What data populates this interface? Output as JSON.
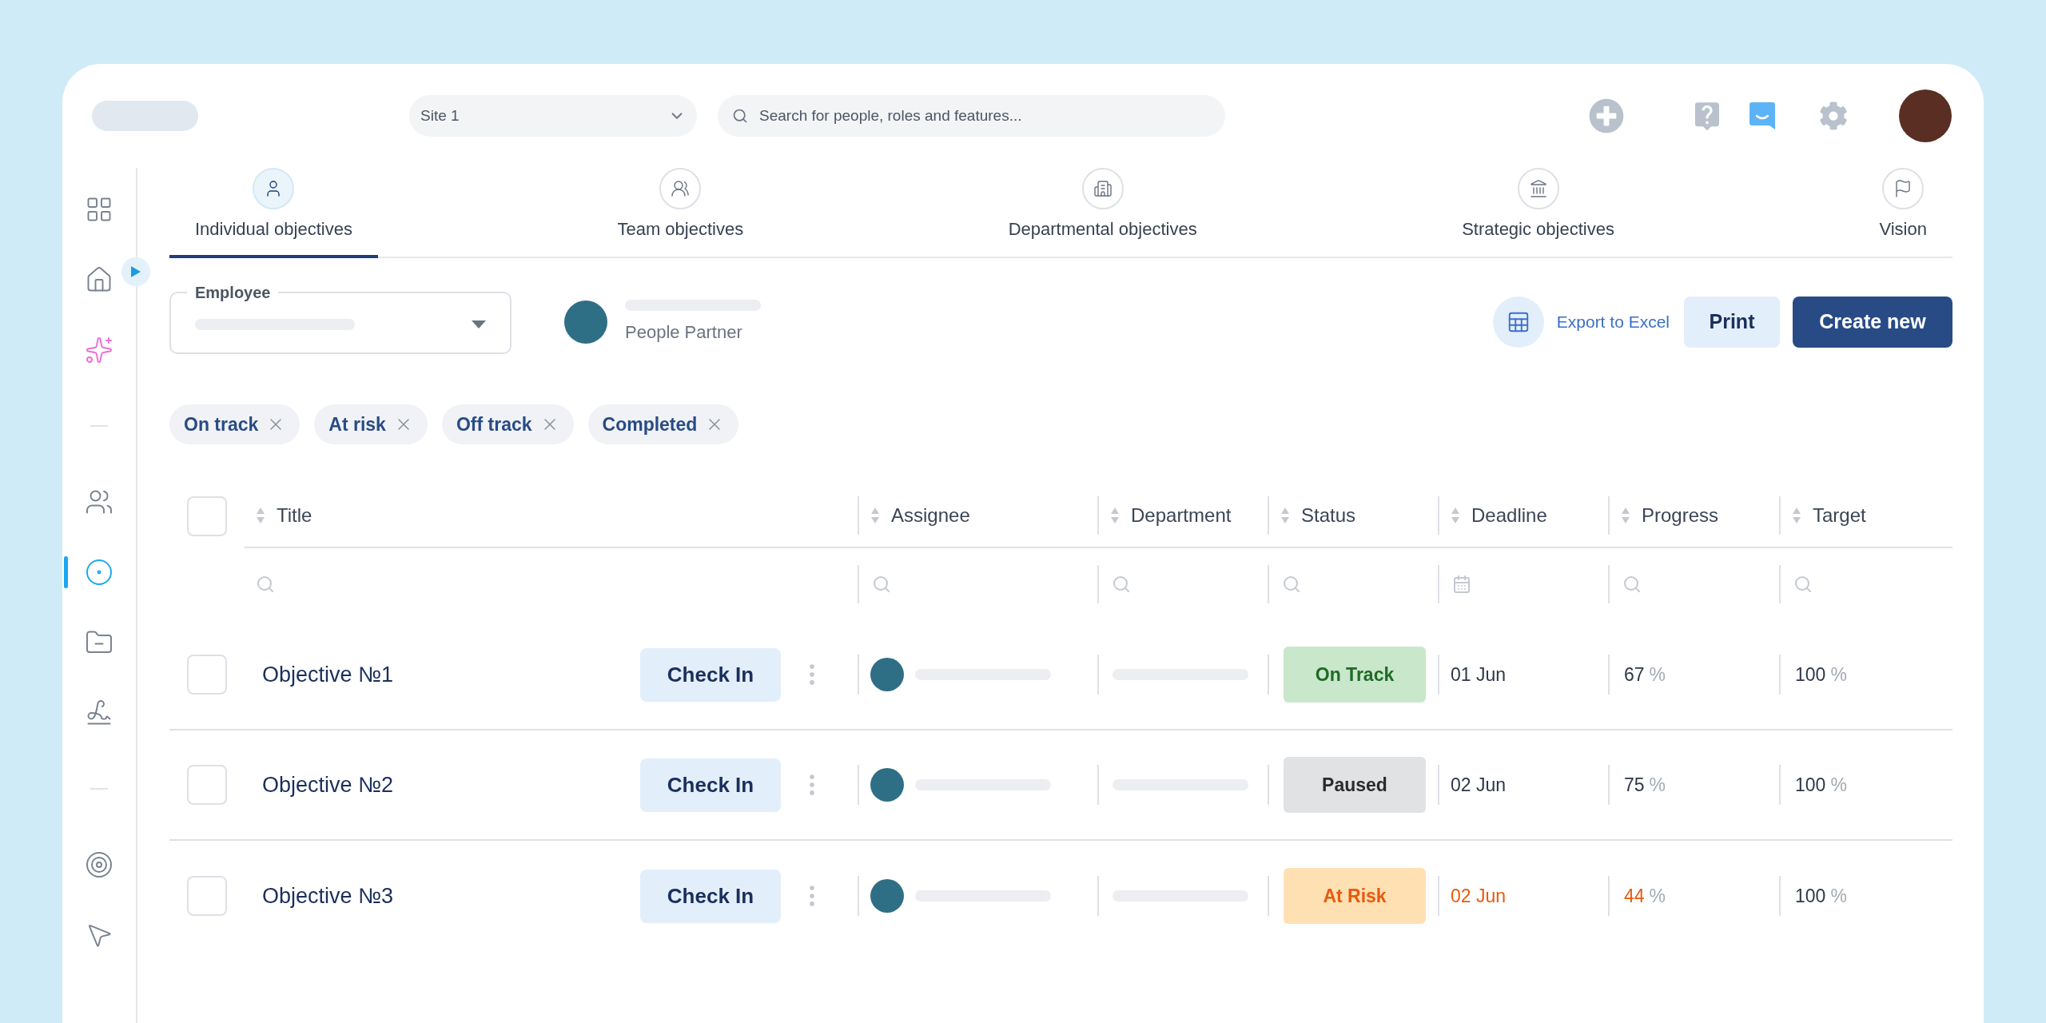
{
  "top_bar": {
    "site_select": {
      "value": "Site 1"
    },
    "search": {
      "placeholder": "Search for people, roles and features..."
    }
  },
  "sidebar": {
    "expanded": false,
    "items": [
      {
        "selected": false
      },
      {
        "selected": false
      },
      {
        "selected": false
      },
      {
        "selected": false
      },
      {
        "selected": true
      },
      {
        "selected": false
      },
      {
        "selected": false
      },
      {
        "selected": false
      },
      {
        "selected": false
      }
    ]
  },
  "tabs": [
    {
      "label": "Individual objectives",
      "selected": true
    },
    {
      "label": "Team objectives",
      "selected": false
    },
    {
      "label": "Departmental objectives",
      "selected": false
    },
    {
      "label": "Strategic objectives",
      "selected": false
    },
    {
      "label": "Vision",
      "selected": false
    }
  ],
  "employee_field": {
    "label": "Employee"
  },
  "people_partner": {
    "role": "People Partner"
  },
  "actions": {
    "export": "Export to Excel",
    "print": "Print",
    "create": "Create new"
  },
  "filter_chips": [
    {
      "label": "On track"
    },
    {
      "label": "At risk"
    },
    {
      "label": "Off track"
    },
    {
      "label": "Completed"
    }
  ],
  "table": {
    "all_checked": false,
    "columns": [
      {
        "label": "Title",
        "kind": "text"
      },
      {
        "label": "Assignee",
        "kind": "text"
      },
      {
        "label": "Department",
        "kind": "text"
      },
      {
        "label": "Status",
        "kind": "text"
      },
      {
        "label": "Deadline",
        "kind": "date"
      },
      {
        "label": "Progress",
        "kind": "text"
      },
      {
        "label": "Target",
        "kind": "text"
      }
    ],
    "rows": [
      {
        "checked": false,
        "title": "Objective №1",
        "action": "Check In",
        "status": {
          "label": "On Track",
          "kind": "on_track"
        },
        "deadline": "01 Jun",
        "progress": "67",
        "progress_unit": "%",
        "target": "100",
        "target_unit": "%"
      },
      {
        "checked": false,
        "title": "Objective №2",
        "action": "Check In",
        "status": {
          "label": "Paused",
          "kind": "paused"
        },
        "deadline": "02 Jun",
        "progress": "75",
        "progress_unit": "%",
        "target": "100",
        "target_unit": "%"
      },
      {
        "checked": false,
        "title": "Objective №3",
        "action": "Check In",
        "status": {
          "label": "At Risk",
          "kind": "at_risk"
        },
        "deadline": "02 Jun",
        "progress": "44",
        "progress_unit": "%",
        "target": "100",
        "target_unit": "%"
      }
    ]
  }
}
